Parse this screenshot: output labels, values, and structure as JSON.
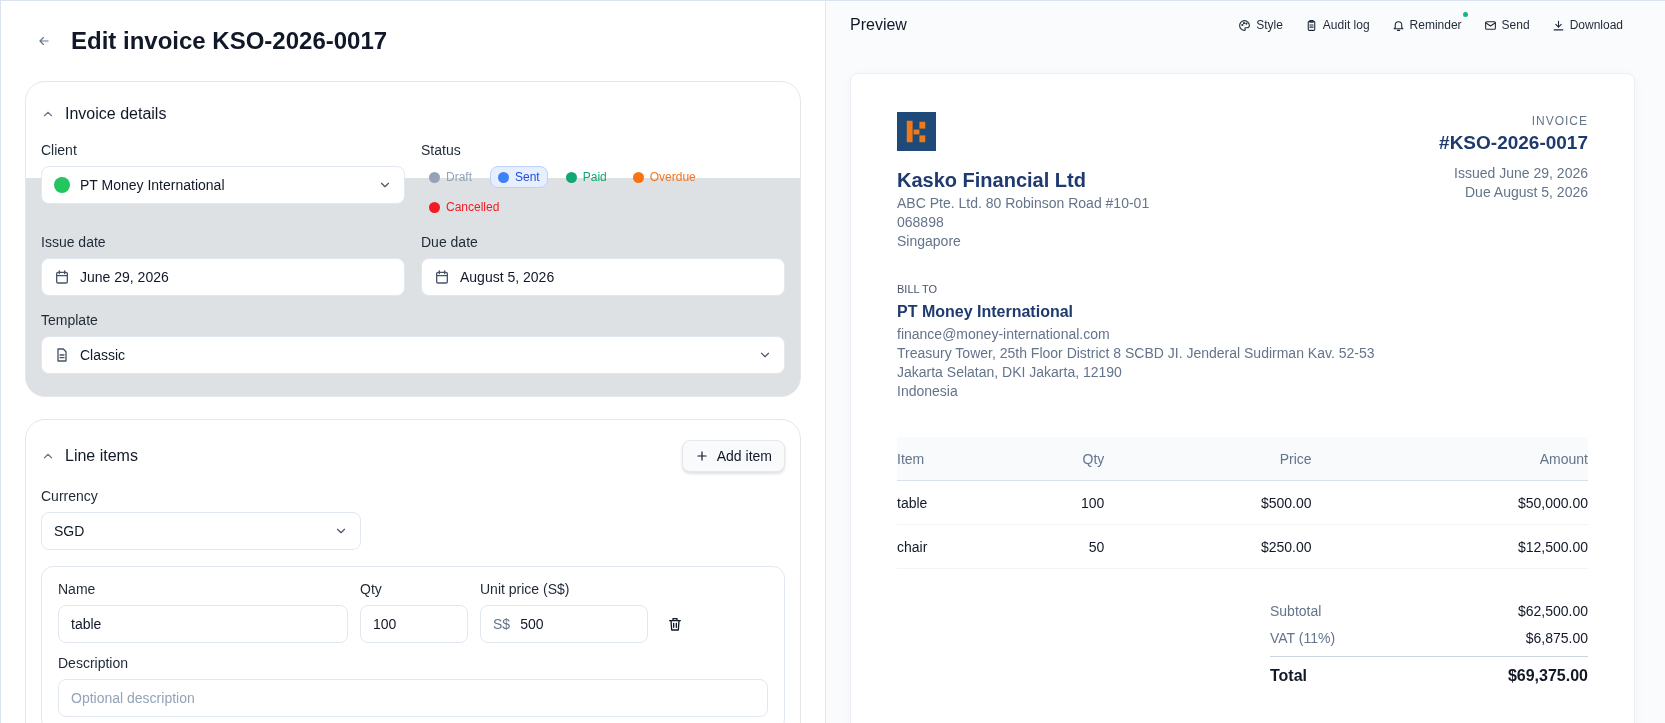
{
  "page": {
    "title": "Edit invoice KSO-2026-0017"
  },
  "invoice_details": {
    "heading": "Invoice details",
    "expanded": true,
    "client": {
      "label": "Client",
      "value": "PT Money International"
    },
    "status": {
      "label": "Status",
      "options": [
        {
          "label": "Draft",
          "color": "#94a3b8",
          "selected": false
        },
        {
          "label": "Sent",
          "color": "#3b82f6",
          "selected": true
        },
        {
          "label": "Paid",
          "color": "#10a872",
          "selected": false
        },
        {
          "label": "Overdue",
          "color": "#f97316",
          "selected": false
        },
        {
          "label": "Cancelled",
          "color": "#ef1c24",
          "selected": false
        }
      ]
    },
    "issue_date": {
      "label": "Issue date",
      "value": "June 29, 2026"
    },
    "due_date": {
      "label": "Due date",
      "value": "August 5, 2026"
    },
    "template": {
      "label": "Template",
      "value": "Classic"
    }
  },
  "line_items": {
    "heading": "Line items",
    "expanded": true,
    "add_button": "Add item",
    "currency": {
      "label": "Currency",
      "value": "SGD"
    },
    "items": [
      {
        "name_label": "Name",
        "name": "table",
        "qty_label": "Qty",
        "qty": "100",
        "price_label": "Unit price (S$)",
        "price_prefix": "S$",
        "price": "500",
        "description_label": "Description",
        "description_placeholder": "Optional description"
      }
    ]
  },
  "preview": {
    "title": "Preview",
    "actions": [
      {
        "label": "Style",
        "notification": false
      },
      {
        "label": "Audit log",
        "notification": false
      },
      {
        "label": "Reminder",
        "notification": true
      },
      {
        "label": "Send",
        "notification": false
      },
      {
        "label": "Download",
        "notification": false
      }
    ],
    "invoice": {
      "company": "Kasko Financial Ltd",
      "company_address": [
        "ABC Pte. Ltd. 80 Robinson Road #10-01",
        "068898",
        "Singapore"
      ],
      "doc_label": "INVOICE",
      "number": "#KSO-2026-0017",
      "issued": "Issued June 29, 2026",
      "due": "Due August 5, 2026",
      "bill_to_label": "BILL TO",
      "client": "PT Money International",
      "client_email": "finance@money-international.com",
      "client_address": [
        "Treasury Tower, 25th Floor District 8 SCBD JI. Jenderal Sudirman Kav. 52-53",
        "Jakarta Selatan, DKI Jakarta, 12190",
        "Indonesia"
      ],
      "table": {
        "columns": [
          "Item",
          "Qty",
          "Price",
          "Amount"
        ],
        "rows": [
          [
            "table",
            "100",
            "$500.00",
            "$50,000.00"
          ],
          [
            "chair",
            "50",
            "$250.00",
            "$12,500.00"
          ]
        ]
      },
      "totals": [
        {
          "kind": "normal",
          "label": "Subtotal",
          "value": "$62,500.00"
        },
        {
          "kind": "normal",
          "label": "VAT (11%)",
          "value": "$6,875.00"
        },
        {
          "kind": "grand",
          "label": "Total",
          "value": "$69,375.00"
        }
      ]
    }
  }
}
